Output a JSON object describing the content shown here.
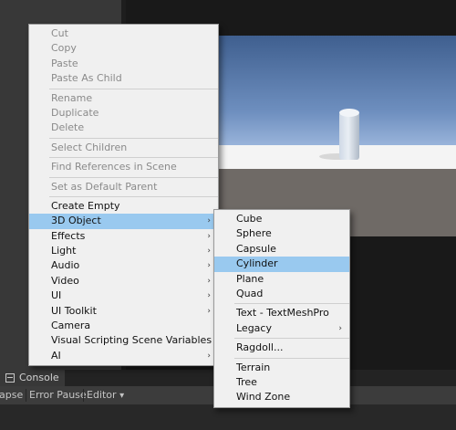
{
  "console": {
    "tab_label": "Console",
    "toolbar": {
      "collapse": "apse",
      "error_pause": "Error Pause",
      "editor": "Editor",
      "editor_arrow": "▾"
    }
  },
  "context_menu": {
    "groups": [
      [
        {
          "label": "Cut",
          "disabled": true
        },
        {
          "label": "Copy",
          "disabled": true
        },
        {
          "label": "Paste",
          "disabled": true
        },
        {
          "label": "Paste As Child",
          "disabled": true
        }
      ],
      [
        {
          "label": "Rename",
          "disabled": true
        },
        {
          "label": "Duplicate",
          "disabled": true
        },
        {
          "label": "Delete",
          "disabled": true
        }
      ],
      [
        {
          "label": "Select Children",
          "disabled": true
        }
      ],
      [
        {
          "label": "Find References in Scene",
          "disabled": true
        }
      ],
      [
        {
          "label": "Set as Default Parent",
          "disabled": true
        }
      ],
      [
        {
          "label": "Create Empty"
        },
        {
          "label": "3D Object",
          "submenu": true,
          "highlighted": true
        },
        {
          "label": "Effects",
          "submenu": true
        },
        {
          "label": "Light",
          "submenu": true
        },
        {
          "label": "Audio",
          "submenu": true
        },
        {
          "label": "Video",
          "submenu": true
        },
        {
          "label": "UI",
          "submenu": true
        },
        {
          "label": "UI Toolkit",
          "submenu": true
        },
        {
          "label": "Camera"
        },
        {
          "label": "Visual Scripting Scene Variables"
        },
        {
          "label": "AI",
          "submenu": true
        }
      ]
    ]
  },
  "submenu_3d_object": {
    "groups": [
      [
        {
          "label": "Cube"
        },
        {
          "label": "Sphere"
        },
        {
          "label": "Capsule"
        },
        {
          "label": "Cylinder",
          "highlighted": true
        },
        {
          "label": "Plane"
        },
        {
          "label": "Quad"
        }
      ],
      [
        {
          "label": "Text - TextMeshPro"
        },
        {
          "label": "Legacy",
          "submenu": true
        }
      ],
      [
        {
          "label": "Ragdoll..."
        }
      ],
      [
        {
          "label": "Terrain"
        },
        {
          "label": "Tree"
        },
        {
          "label": "Wind Zone"
        }
      ]
    ]
  },
  "arrow_glyph": "›"
}
